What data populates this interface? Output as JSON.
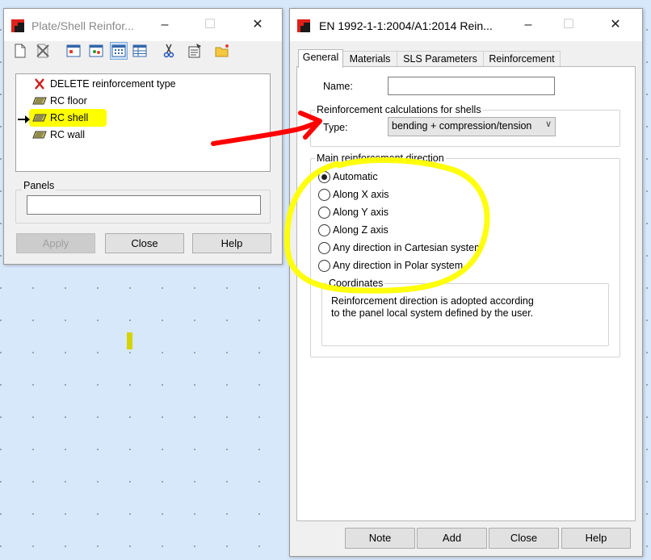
{
  "left_window": {
    "title": "Plate/Shell Reinfor...",
    "tree": {
      "items": [
        {
          "label": "DELETE reinforcement type",
          "icon": "delete-x-icon"
        },
        {
          "label": "RC floor",
          "icon": "rc-type-icon"
        },
        {
          "label": "RC shell",
          "icon": "rc-type-icon",
          "selected": true,
          "highlight": true
        },
        {
          "label": "RC wall",
          "icon": "rc-type-icon"
        }
      ]
    },
    "panels": {
      "label": "Panels",
      "value": ""
    },
    "buttons": {
      "apply": "Apply",
      "close": "Close",
      "help": "Help"
    }
  },
  "right_window": {
    "title": "EN 1992-1-1:2004/A1:2014 Rein...",
    "tabs": [
      "General",
      "Materials",
      "SLS Parameters",
      "Reinforcement"
    ],
    "active_tab": "General",
    "name": {
      "label": "Name:",
      "value": ""
    },
    "calc_group": {
      "label": "Reinforcement calculations for shells",
      "type_label": "Type:",
      "type_value": "bending + compression/tension"
    },
    "direction_group": {
      "label": "Main reinforcement direction",
      "options": [
        "Automatic",
        "Along X axis",
        "Along Y axis",
        "Along Z axis",
        "Any direction in Cartesian system",
        "Any direction in Polar system"
      ],
      "selected": "Automatic"
    },
    "coordinates": {
      "label": "Coordinates",
      "line1": "Reinforcement direction is adopted according",
      "line2": "to the panel local system defined by the user."
    },
    "buttons": {
      "note": "Note",
      "add": "Add",
      "close": "Close",
      "help": "Help"
    }
  },
  "colors": {
    "highlight": "#ffff00",
    "annotation_arrow": "#ff0000",
    "annotation_circle": "#ffff00",
    "desktop": "#d8e8fb"
  }
}
